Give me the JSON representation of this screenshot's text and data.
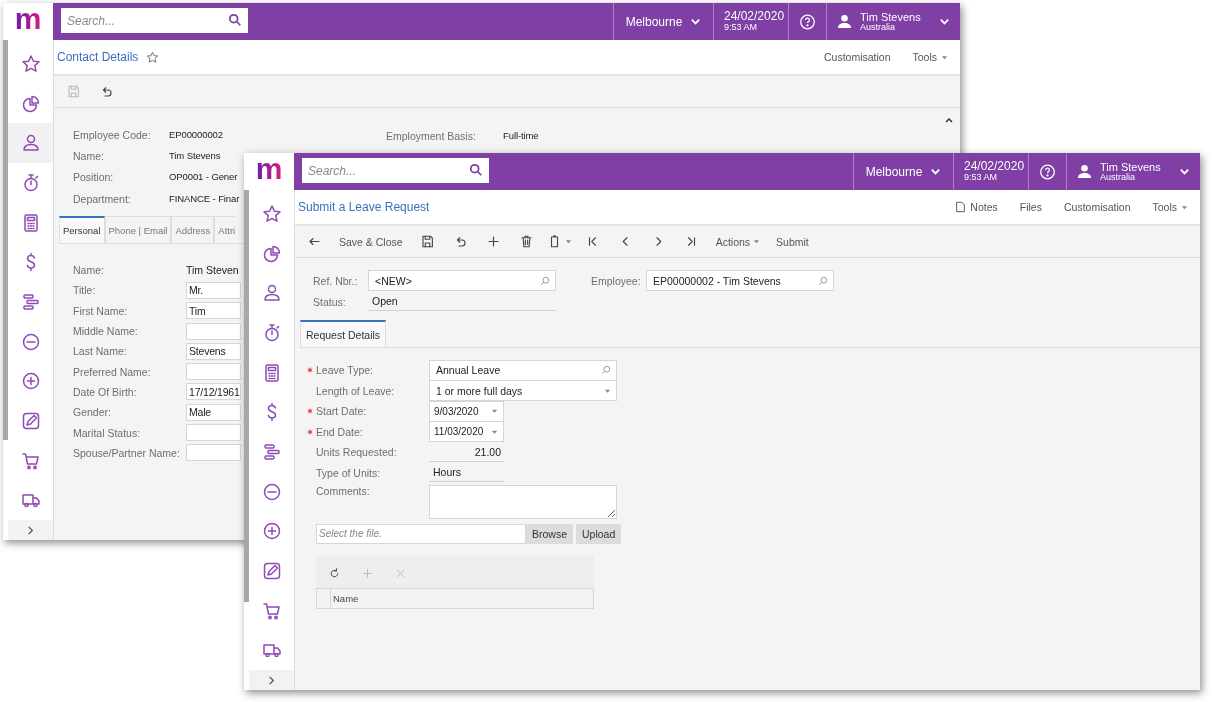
{
  "back_window": {
    "logo": "m",
    "search": {
      "placeholder": "Search..."
    },
    "branch": "Melbourne",
    "date": "24/02/2020",
    "time": "9:53 AM",
    "user": {
      "name": "Tim Stevens",
      "country": "Australia"
    },
    "sidebar": [
      {
        "kind": "star",
        "selected": false
      },
      {
        "kind": "pie",
        "selected": false
      },
      {
        "kind": "person",
        "selected": true
      },
      {
        "kind": "stopwatch",
        "selected": false
      },
      {
        "kind": "calculator",
        "selected": false
      },
      {
        "kind": "dollar",
        "selected": false
      },
      {
        "kind": "bars",
        "selected": false
      },
      {
        "kind": "minus",
        "selected": false
      },
      {
        "kind": "plus",
        "selected": false
      },
      {
        "kind": "pencil",
        "selected": false
      },
      {
        "kind": "cart",
        "selected": false
      },
      {
        "kind": "truck",
        "selected": false
      }
    ],
    "title": "Contact Details",
    "header_links": [
      {
        "kind": "text",
        "label": "Customisation"
      },
      {
        "kind": "menu",
        "label": "Tools"
      }
    ],
    "toolbar": [
      {
        "kind": "save",
        "disabled": true
      },
      {
        "kind": "undo",
        "disabled": false
      }
    ],
    "summary_left": [
      {
        "label": "Employee Code:",
        "value": "EP00000002"
      },
      {
        "label": "Name:",
        "value": "Tim Stevens"
      },
      {
        "label": "Position:",
        "value": "OP0001 - Gener"
      },
      {
        "label": "Department:",
        "value": "FINANCE - Finar"
      }
    ],
    "summary_right": [
      {
        "label": "Employment Basis:",
        "value": "Full-time"
      }
    ],
    "tabs": [
      {
        "label": "Personal",
        "selected": true
      },
      {
        "label": "Phone | Email",
        "selected": false
      },
      {
        "label": "Address",
        "selected": false
      },
      {
        "label": "Attri",
        "selected": false
      }
    ],
    "fields": [
      {
        "label": "Name:",
        "kind": "text",
        "value": "Tim Steven"
      },
      {
        "label": "Title:",
        "kind": "input",
        "value": "Mr."
      },
      {
        "label": "First Name:",
        "kind": "input",
        "value": "Tim"
      },
      {
        "label": "Middle Name:",
        "kind": "input"
      },
      {
        "label": "Last Name:",
        "kind": "input",
        "value": "Stevens"
      },
      {
        "label": "Preferred Name:",
        "kind": "input"
      },
      {
        "label": "Date Of Birth:",
        "kind": "input",
        "value": "17/12/1961"
      },
      {
        "label": "Gender:",
        "kind": "input",
        "value": "Male"
      },
      {
        "label": "Marital Status:",
        "kind": "input"
      },
      {
        "label": "Spouse/Partner Name:",
        "kind": "input"
      }
    ]
  },
  "front_window": {
    "logo": "m",
    "search": {
      "placeholder": "Search..."
    },
    "branch": "Melbourne",
    "date": "24/02/2020",
    "time": "9:53 AM",
    "user": {
      "name": "Tim Stevens",
      "country": "Australia"
    },
    "sidebar": [
      {
        "kind": "star",
        "selected": false
      },
      {
        "kind": "pie",
        "selected": false
      },
      {
        "kind": "person",
        "selected": false
      },
      {
        "kind": "stopwatch",
        "selected": false
      },
      {
        "kind": "calculator",
        "selected": false
      },
      {
        "kind": "dollar",
        "selected": false
      },
      {
        "kind": "bars",
        "selected": false
      },
      {
        "kind": "minus",
        "selected": false
      },
      {
        "kind": "plus",
        "selected": false
      },
      {
        "kind": "pencil",
        "selected": false
      },
      {
        "kind": "cart",
        "selected": false
      },
      {
        "kind": "truck",
        "selected": false
      }
    ],
    "title": "Submit a Leave Request",
    "header_links": [
      {
        "kind": "notes",
        "label": "Notes"
      },
      {
        "kind": "text",
        "label": "Files"
      },
      {
        "kind": "text",
        "label": "Customisation"
      },
      {
        "kind": "menu",
        "label": "Tools"
      }
    ],
    "toolbar": [
      {
        "kind": "back"
      },
      {
        "kind": "text",
        "label": "Save & Close"
      },
      {
        "kind": "save"
      },
      {
        "kind": "undo"
      },
      {
        "kind": "add"
      },
      {
        "kind": "delete"
      },
      {
        "kind": "copy"
      },
      {
        "kind": "first"
      },
      {
        "kind": "prev"
      },
      {
        "kind": "next"
      },
      {
        "kind": "last"
      },
      {
        "kind": "menu",
        "label": "Actions"
      },
      {
        "kind": "text",
        "label": "Submit"
      }
    ],
    "ref_nbr": {
      "label": "Ref. Nbr.:",
      "value": "<NEW>"
    },
    "status": {
      "label": "Status:",
      "value": "Open"
    },
    "employee": {
      "label": "Employee:",
      "value": "EP00000002 - Tim Stevens"
    },
    "tabs": [
      {
        "label": "Request Details",
        "selected": true
      }
    ],
    "fields": [
      {
        "label": "Leave Type:",
        "required": true,
        "kind": "lookup",
        "value": "Annual Leave"
      },
      {
        "label": "Length of Leave:",
        "required": false,
        "kind": "select",
        "value": "1 or more full days"
      },
      {
        "label": "Start Date:",
        "required": true,
        "kind": "date",
        "value": "9/03/2020"
      },
      {
        "label": "End Date:",
        "required": true,
        "kind": "date",
        "value": "11/03/2020"
      },
      {
        "label": "Units Requested:",
        "required": false,
        "kind": "number",
        "value": "21.00"
      },
      {
        "label": "Type of Units:",
        "required": false,
        "kind": "readonly",
        "value": "Hours"
      },
      {
        "label": "Comments:",
        "required": false,
        "kind": "textarea"
      }
    ],
    "file": {
      "placeholder": "Select the file.",
      "buttons": [
        "Browse",
        "Upload"
      ]
    },
    "grid": {
      "toolbar": [
        {
          "kind": "refresh",
          "disabled": false
        },
        {
          "kind": "add",
          "disabled": true
        },
        {
          "kind": "close",
          "disabled": true
        }
      ],
      "columns": [
        "Name"
      ]
    }
  }
}
